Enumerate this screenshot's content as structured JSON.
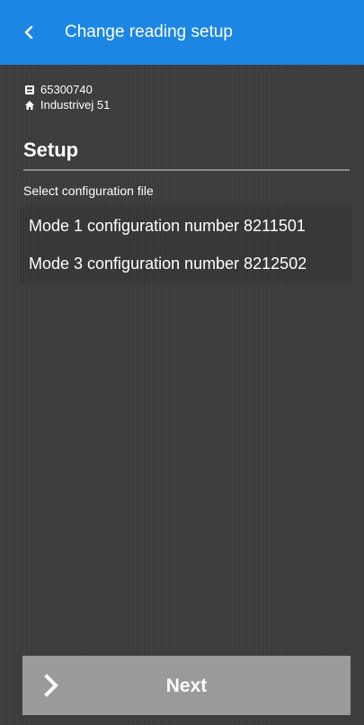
{
  "header": {
    "title": "Change reading setup",
    "back_icon": "chevron-left-icon",
    "color": "#1b86e3"
  },
  "meter": {
    "number": "65300740",
    "number_icon": "meter-icon",
    "address": "Industrivej 51",
    "address_icon": "home-icon"
  },
  "setup": {
    "title": "Setup",
    "subtitle": "Select configuration file",
    "options": [
      {
        "label": "Mode 1 configuration number 8211501"
      },
      {
        "label": "Mode 3 configuration number 8212502"
      }
    ]
  },
  "footer": {
    "next_label": "Next",
    "next_icon": "chevron-right-icon",
    "button_color": "#9a9a9a"
  }
}
